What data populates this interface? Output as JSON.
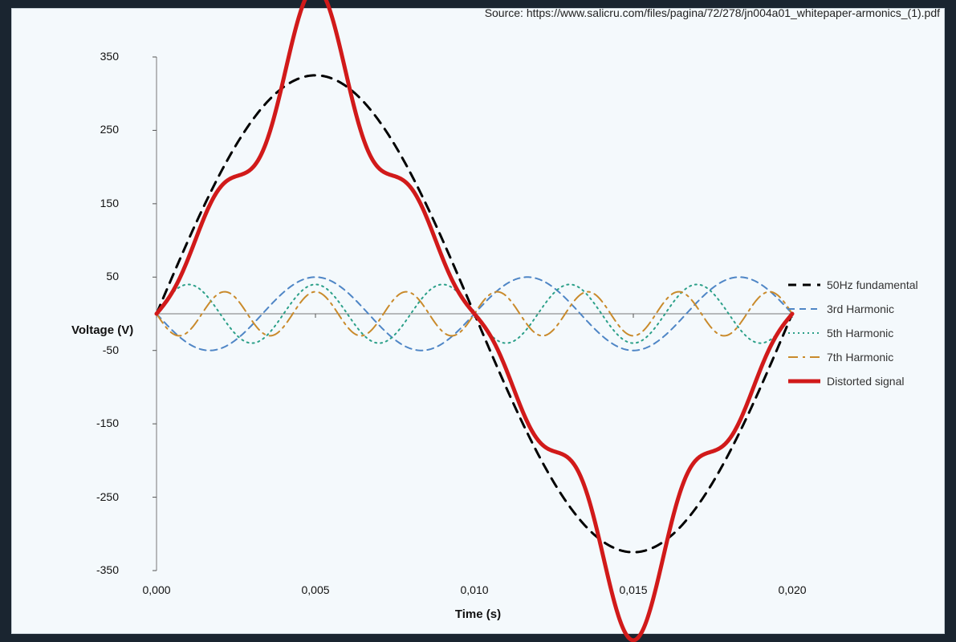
{
  "source_attribution": "Source: https://www.salicru.com/files/pagina/72/278/jn004a01_whitepaper-armonics_(1).pdf",
  "axis": {
    "y_title": "Voltage (V)",
    "x_title": "Time (s)",
    "y_ticks": [
      "-350",
      "-250",
      "-150",
      "-50",
      "50",
      "150",
      "250",
      "350"
    ],
    "x_ticks": [
      "0,000",
      "0,005",
      "0,010",
      "0,015",
      "0,020"
    ]
  },
  "legend": {
    "items": [
      {
        "label": "50Hz fundamental",
        "color": "#000000",
        "dash": "10,8",
        "width": 3
      },
      {
        "label": "3rd Harmonic",
        "color": "#4f86c6",
        "dash": "8,6",
        "width": 2
      },
      {
        "label": "5th Harmonic",
        "color": "#2ca089",
        "dash": "2,4",
        "width": 2
      },
      {
        "label": "7th Harmonic",
        "color": "#c98a2b",
        "dash": "12,6,3,6",
        "width": 2
      },
      {
        "label": "Distorted signal",
        "color": "#d11a1a",
        "dash": "",
        "width": 5
      }
    ]
  },
  "chart_data": {
    "type": "line",
    "xlabel": "Time (s)",
    "ylabel": "Voltage (V)",
    "xlim": [
      0.0,
      0.02
    ],
    "ylim": [
      -350,
      350
    ],
    "x_tick_values": [
      0.0,
      0.005,
      0.01,
      0.015,
      0.02
    ],
    "y_tick_values": [
      -350,
      -250,
      -150,
      -50,
      50,
      150,
      250,
      350
    ],
    "series": [
      {
        "name": "50Hz fundamental",
        "kind": "sinusoid",
        "frequency_hz": 50,
        "amplitude_v": 325,
        "phase_deg": 0,
        "color": "#000000",
        "dash": "long-dash"
      },
      {
        "name": "3rd Harmonic",
        "kind": "sinusoid",
        "frequency_hz": 150,
        "amplitude_v": 50,
        "phase_deg": 180,
        "color": "#4f86c6",
        "dash": "dash"
      },
      {
        "name": "5th Harmonic",
        "kind": "sinusoid",
        "frequency_hz": 250,
        "amplitude_v": 40,
        "phase_deg": 0,
        "color": "#2ca089",
        "dash": "dot"
      },
      {
        "name": "7th Harmonic",
        "kind": "sinusoid",
        "frequency_hz": 350,
        "amplitude_v": 30,
        "phase_deg": 180,
        "color": "#c98a2b",
        "dash": "dash-dot"
      },
      {
        "name": "Distorted signal",
        "kind": "sum",
        "components": [
          "50Hz fundamental",
          "3rd Harmonic",
          "5th Harmonic",
          "7th Harmonic"
        ],
        "color": "#d11a1a",
        "dash": "solid"
      }
    ],
    "grid": false,
    "legend_position": "right"
  }
}
